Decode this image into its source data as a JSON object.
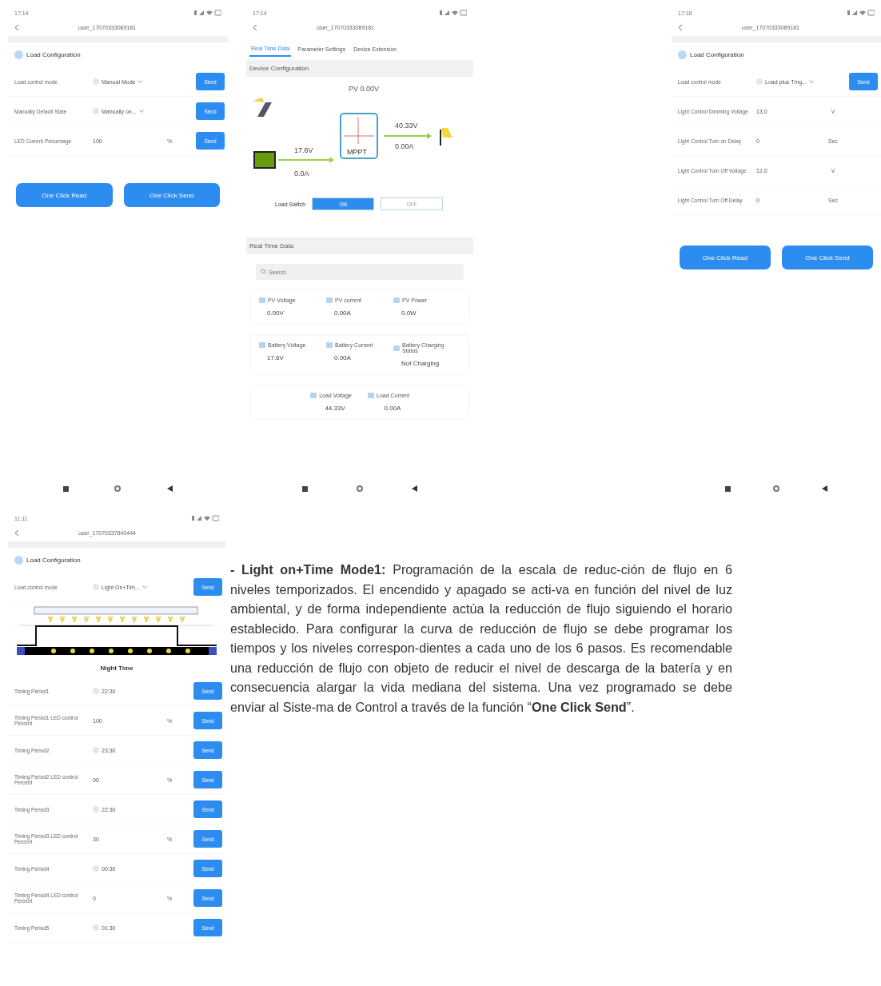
{
  "phones": [
    {
      "kind": "config",
      "status_time": "17:14",
      "device": "user_17070333089181",
      "header": "Load Configuration",
      "rows": [
        {
          "label": "Load control mode",
          "kind": "select",
          "value": "Manual Mode",
          "action": "Send"
        },
        {
          "label": "Manually Default State",
          "kind": "select",
          "value": "Manually on...",
          "action": "Send"
        },
        {
          "label": "LED Current Percentage",
          "kind": "number",
          "value": "100",
          "unit": "%",
          "action": "Send"
        }
      ],
      "buttons": [
        "One Click Read",
        "One Click Send"
      ]
    },
    {
      "kind": "realtime",
      "status_time": "17:14",
      "device": "user_17070333089181",
      "tabs": [
        {
          "label": "Real Time Data",
          "selected": true
        },
        {
          "label": "Parameter Settings",
          "selected": false
        },
        {
          "label": "Device Extension",
          "selected": false
        }
      ],
      "section": "Device Configuration",
      "diagram": {
        "pv_label": "PV 0.00V",
        "battery_voltage": "17.6V",
        "battery_current": "0.0A",
        "controller": "MPPT",
        "load_voltage": "40.33V",
        "load_current": "0.00A"
      },
      "load_switch": {
        "label": "Load Switch",
        "options": [
          {
            "label": "ON",
            "selected": true
          },
          {
            "label": "OFF",
            "selected": false
          }
        ]
      },
      "data_title": "Real Time Data",
      "search": {
        "placeholder": "Search"
      },
      "cards": [
        [
          {
            "label": "PV Voltage",
            "value": "0.00V"
          },
          {
            "label": "PV current",
            "value": "0.00A"
          },
          {
            "label": "PV Power",
            "value": "0.0W"
          }
        ],
        [
          {
            "label": "Battery Voltage",
            "value": "17.6V"
          },
          {
            "label": "Battery Current",
            "value": "0.00A"
          },
          {
            "label": "Battery Charging Status",
            "value": "Not Charging"
          }
        ],
        [
          {
            "label": "Load Voltage",
            "value": "44.33V"
          },
          {
            "label": "Load Current",
            "value": "0.00A"
          }
        ]
      ]
    },
    {
      "kind": "config",
      "status_time": "17:18",
      "device": "user_17070333089181",
      "header": "Load Configuration",
      "rows": [
        {
          "label": "Load control mode",
          "kind": "select",
          "value": "Load plus Tmg...",
          "action": "Send"
        },
        {
          "label": "Light Control Dimming Voltage",
          "kind": "number",
          "value": "13.0",
          "unit": "V"
        },
        {
          "label": "Light Control Turn on Delay",
          "kind": "number",
          "value": "0",
          "unit": "Sec"
        },
        {
          "label": "Light Control Turn Off Voltage",
          "kind": "number",
          "value": "12.0",
          "unit": "V"
        },
        {
          "label": "Light Control Turn Off Delay",
          "kind": "number",
          "value": "0",
          "unit": "Sec"
        }
      ],
      "buttons": [
        "One Click Read",
        "One Click Send"
      ]
    },
    {
      "kind": "config",
      "status_time": "11:11",
      "device": "user_17070337840444",
      "header": "Load Configuration",
      "rows": [
        {
          "label": "Load control mode",
          "kind": "select",
          "value": "Light On+Tim...",
          "action": "Send"
        }
      ],
      "schedule": {
        "caption": "Night Time"
      },
      "timing_rows": [
        {
          "label": "Timing Period1",
          "kind": "time",
          "value": "22:30",
          "action": "Send"
        },
        {
          "label": "Timing Period1 LED control Percent",
          "kind": "number",
          "value": "100",
          "unit": "%",
          "action": "Send"
        },
        {
          "label": "Timing Period2",
          "kind": "time",
          "value": "23:30",
          "action": "Send"
        },
        {
          "label": "Timing Period2 LED control Percent",
          "kind": "number",
          "value": "90",
          "unit": "%",
          "action": "Send"
        },
        {
          "label": "Timing Period3",
          "kind": "time",
          "value": "22:30",
          "action": "Send"
        },
        {
          "label": "Timing Period3 LED control Percent",
          "kind": "number",
          "value": "30",
          "unit": "%",
          "action": "Send"
        },
        {
          "label": "Timing Period4",
          "kind": "time",
          "value": "00:30",
          "action": "Send"
        },
        {
          "label": "Timing Period4 LED control Percent",
          "kind": "number",
          "value": "0",
          "unit": "%",
          "action": "Send"
        },
        {
          "label": "Timing Period5",
          "kind": "time",
          "value": "01:30",
          "action": "Send"
        }
      ]
    }
  ],
  "paragraph": "**- Light on+Time Mode1:** Programación de la escala de reduc-ción de flujo en 6 niveles temporizados. El encendido y apagado se acti-va en función del nivel de luz ambiental, y de forma independiente actúa la reducción de flujo siguiendo el horario establecido. Para configurar la curva de reducción de flujo se debe programar los tiempos y los niveles correspon-dientes a cada uno de los 6 pasos. Es recomendable una reducción de flujo con objeto de reducir el nivel de descarga de la batería y en consecuencia alargar la vida mediana del sistema. Una vez programado se debe enviar al Siste-ma de Control a través de la función “**One Click Send**”."
}
